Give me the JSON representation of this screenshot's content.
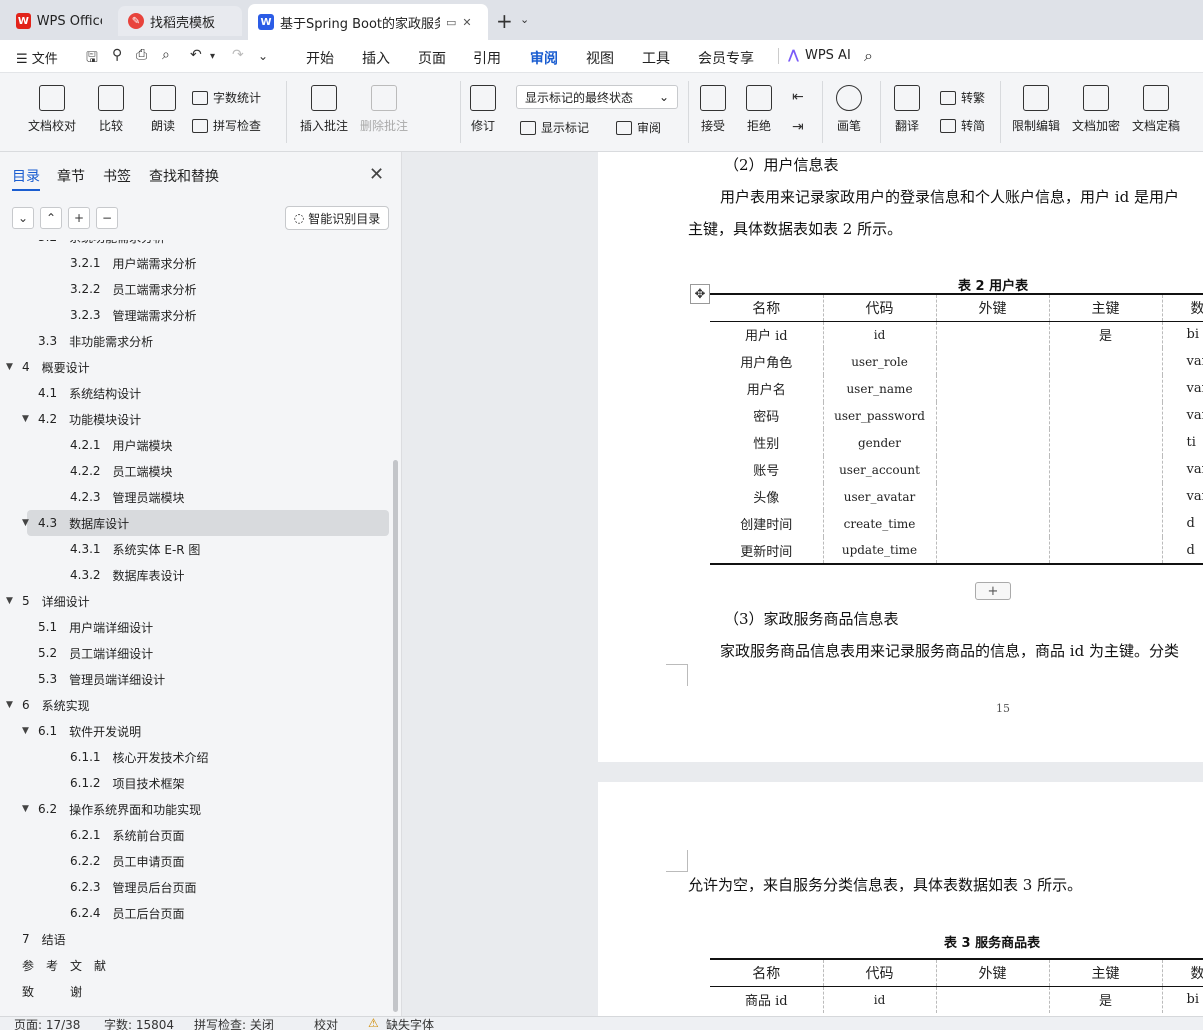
{
  "tabs": [
    {
      "label": "WPS Office",
      "icon": "wps-logo-icon"
    },
    {
      "label": "找稻壳模板",
      "icon": "docer-icon"
    },
    {
      "label": "基于Spring Boot的家政服务系统",
      "icon": "word-doc-icon"
    }
  ],
  "menu": {
    "file": "文件",
    "tabs": [
      "开始",
      "插入",
      "页面",
      "引用",
      "审阅",
      "视图",
      "工具",
      "会员专享"
    ],
    "active": "审阅",
    "ai": "WPS AI"
  },
  "ribbon": {
    "doc_check": "文档校对",
    "compare": "比较",
    "read_aloud": "朗读",
    "word_count": "字数统计",
    "spell_check": "拼写检查",
    "insert_comment": "插入批注",
    "delete_comment": "删除批注",
    "track_changes": "修订",
    "markup_mode": "显示标记的最终状态",
    "show_markup": "显示标记",
    "review": "审阅",
    "accept": "接受",
    "reject": "拒绝",
    "pen": "画笔",
    "translate": "翻译",
    "to_traditional": "转繁",
    "to_simplified": "转简",
    "restrict_edit": "限制编辑",
    "encrypt": "文档加密",
    "finalize": "文档定稿"
  },
  "nav": {
    "tabs": [
      "目录",
      "章节",
      "书签",
      "查找和替换"
    ],
    "active": "目录",
    "smart_toc": "智能识别目录",
    "toc": [
      {
        "num": "3.2",
        "title": "系统功能需求分析",
        "level": 2,
        "twisty": "open"
      },
      {
        "num": "3.2.1",
        "title": "用户端需求分析",
        "level": 3
      },
      {
        "num": "3.2.2",
        "title": "员工端需求分析",
        "level": 3
      },
      {
        "num": "3.2.3",
        "title": "管理端需求分析",
        "level": 3
      },
      {
        "num": "3.3",
        "title": "非功能需求分析",
        "level": 2
      },
      {
        "num": "4",
        "title": "概要设计",
        "level": 1,
        "twisty": "open"
      },
      {
        "num": "4.1",
        "title": "系统结构设计",
        "level": 2
      },
      {
        "num": "4.2",
        "title": "功能模块设计",
        "level": 2,
        "twisty": "open"
      },
      {
        "num": "4.2.1",
        "title": "用户端模块",
        "level": 3
      },
      {
        "num": "4.2.2",
        "title": "员工端模块",
        "level": 3
      },
      {
        "num": "4.2.3",
        "title": "管理员端模块",
        "level": 3
      },
      {
        "num": "4.3",
        "title": "数据库设计",
        "level": 2,
        "twisty": "open",
        "selected": true
      },
      {
        "num": "4.3.1",
        "title": "系统实体 E-R 图",
        "level": 3
      },
      {
        "num": "4.3.2",
        "title": "数据库表设计",
        "level": 3
      },
      {
        "num": "5",
        "title": "详细设计",
        "level": 1,
        "twisty": "open"
      },
      {
        "num": "5.1",
        "title": "用户端详细设计",
        "level": 2
      },
      {
        "num": "5.2",
        "title": "员工端详细设计",
        "level": 2
      },
      {
        "num": "5.3",
        "title": "管理员端详细设计",
        "level": 2
      },
      {
        "num": "6",
        "title": "系统实现",
        "level": 1,
        "twisty": "open"
      },
      {
        "num": "6.1",
        "title": "软件开发说明",
        "level": 2,
        "twisty": "open"
      },
      {
        "num": "6.1.1",
        "title": "核心开发技术介绍",
        "level": 3
      },
      {
        "num": "6.1.2",
        "title": "项目技术框架",
        "level": 3
      },
      {
        "num": "6.2",
        "title": "操作系统界面和功能实现",
        "level": 2,
        "twisty": "open"
      },
      {
        "num": "6.2.1",
        "title": "系统前台页面",
        "level": 3
      },
      {
        "num": "6.2.2",
        "title": "员工申请页面",
        "level": 3
      },
      {
        "num": "6.2.3",
        "title": "管理员后台页面",
        "level": 3
      },
      {
        "num": "6.2.4",
        "title": "员工后台页面",
        "level": 3
      },
      {
        "num": "7",
        "title": "结语",
        "level": 1
      },
      {
        "num": "",
        "title": "参　考　文　献",
        "level": 1
      },
      {
        "num": "",
        "title": "致　　　谢",
        "level": 1
      }
    ]
  },
  "doc": {
    "heading2": "（2）用户信息表",
    "para2_line1": "用户表用来记录家政用户的登录信息和个人账户信息，用户 id 是用户",
    "para2_line2": "主键，具体数据表如表 2 所示。",
    "table2_caption": "表 2  用户表",
    "table2_headers": [
      "名称",
      "代码",
      "外键",
      "主键",
      "数"
    ],
    "table2_rows": [
      [
        "用户 id",
        "id",
        "",
        "是",
        "bi"
      ],
      [
        "用户角色",
        "user_role",
        "",
        "",
        "var"
      ],
      [
        "用户名",
        "user_name",
        "",
        "",
        "var"
      ],
      [
        "密码",
        "user_password",
        "",
        "",
        "var"
      ],
      [
        "性别",
        "gender",
        "",
        "",
        "ti"
      ],
      [
        "账号",
        "user_account",
        "",
        "",
        "var"
      ],
      [
        "头像",
        "user_avatar",
        "",
        "",
        "var"
      ],
      [
        "创建时间",
        "create_time",
        "",
        "",
        "d"
      ],
      [
        "更新时间",
        "update_time",
        "",
        "",
        "d"
      ]
    ],
    "heading3": "（3）家政服务商品信息表",
    "para3": "家政服务商品信息表用来记录服务商品的信息，商品 id 为主键。分类",
    "page_number": "15",
    "page2_para": "允许为空，来自服务分类信息表，具体表数据如表 3 所示。",
    "table3_caption": "表 3  服务商品表",
    "table3_headers": [
      "名称",
      "代码",
      "外键",
      "主键",
      "数"
    ],
    "table3_rows": [
      [
        "商品 id",
        "id",
        "",
        "是",
        "bi"
      ]
    ]
  },
  "status": {
    "page": "页面: 17/38",
    "words": "字数: 15804",
    "spell": "拼写检查: 关闭",
    "proof": "校对",
    "missing_font": "缺失字体"
  },
  "colors": {
    "accent": "#1a5dd0",
    "wps_red": "#e2231a",
    "doc_blue": "#2b5ce6"
  }
}
